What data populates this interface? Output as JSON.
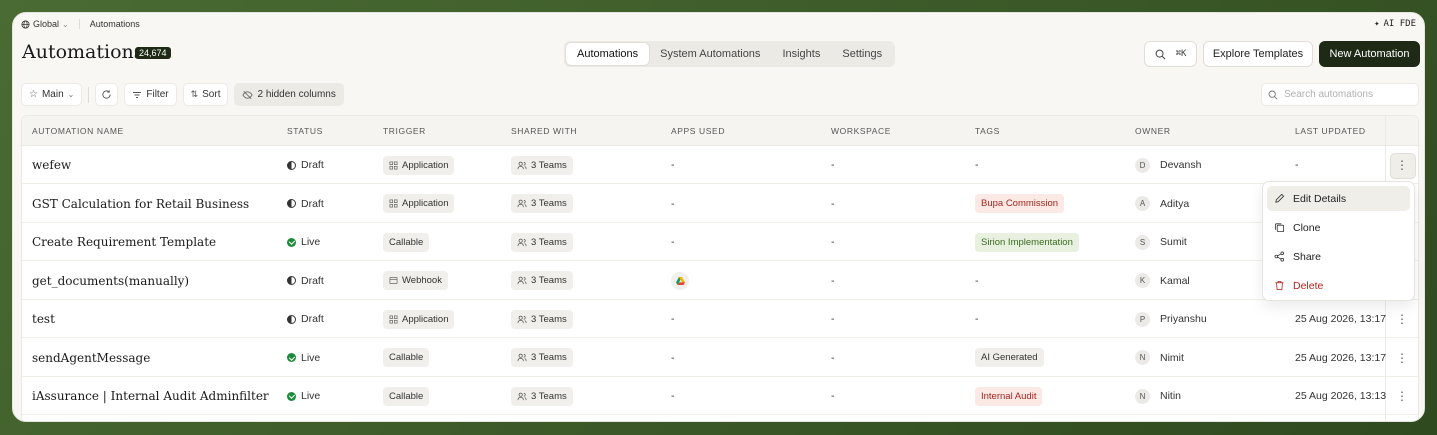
{
  "topbar": {
    "scope": "Global",
    "breadcrumb": "Automations",
    "brand": "AI FDE"
  },
  "header": {
    "title": "Automations",
    "count": "24,674",
    "tabs": [
      {
        "label": "Automations",
        "active": true
      },
      {
        "label": "System Automations",
        "active": false
      },
      {
        "label": "Insights",
        "active": false
      },
      {
        "label": "Settings",
        "active": false
      }
    ],
    "shortcut": "⌘K",
    "explore_label": "Explore Templates",
    "new_label": "New Automation"
  },
  "toolbar": {
    "view": "Main",
    "filter": "Filter",
    "sort": "Sort",
    "hidden_columns": "2 hidden columns",
    "search_placeholder": "Search automations"
  },
  "table": {
    "columns": [
      "AUTOMATION NAME",
      "STATUS",
      "TRIGGER",
      "SHARED WITH",
      "APPS USED",
      "WORKSPACE",
      "TAGS",
      "OWNER",
      "LAST UPDATED"
    ],
    "rows": [
      {
        "name": "wefew",
        "status": "Draft",
        "trigger": "Application",
        "shared": "3 Teams",
        "apps": "-",
        "workspace": "-",
        "tag": "-",
        "owner_initial": "D",
        "owner": "Devansh",
        "updated": "-"
      },
      {
        "name": "GST Calculation for Retail Business",
        "status": "Draft",
        "trigger": "Application",
        "shared": "3 Teams",
        "apps": "-",
        "workspace": "-",
        "tag": "Bupa Commission",
        "owner_initial": "A",
        "owner": "Aditya",
        "updated": ""
      },
      {
        "name": "Create Requirement Template",
        "status": "Live",
        "trigger": "Callable",
        "shared": "3 Teams",
        "apps": "-",
        "workspace": "-",
        "tag": "Sirion Implementation",
        "owner_initial": "S",
        "owner": "Sumit",
        "updated": ""
      },
      {
        "name": "get_documents(manually)",
        "status": "Draft",
        "trigger": "Webhook",
        "shared": "3 Teams",
        "apps": "",
        "workspace": "-",
        "tag": "-",
        "owner_initial": "K",
        "owner": "Kamal",
        "updated": ""
      },
      {
        "name": "test",
        "status": "Draft",
        "trigger": "Application",
        "shared": "3 Teams",
        "apps": "-",
        "workspace": "-",
        "tag": "-",
        "owner_initial": "P",
        "owner": "Priyanshu",
        "updated": "25 Aug 2026, 13:17"
      },
      {
        "name": "sendAgentMessage",
        "status": "Live",
        "trigger": "Callable",
        "shared": "3 Teams",
        "apps": "-",
        "workspace": "-",
        "tag": "AI Generated",
        "owner_initial": "N",
        "owner": "Nimit",
        "updated": "25 Aug 2026, 13:17"
      },
      {
        "name": "iAssurance | Internal Audit Adminfilter",
        "status": "Live",
        "trigger": "Callable",
        "shared": "3 Teams",
        "apps": "-",
        "workspace": "-",
        "tag": "Internal Audit",
        "owner_initial": "N",
        "owner": "Nitin",
        "updated": "25 Aug 2026, 13:13"
      }
    ]
  },
  "menu": {
    "items": [
      {
        "label": "Edit Details"
      },
      {
        "label": "Clone"
      },
      {
        "label": "Share"
      },
      {
        "label": "Delete"
      }
    ]
  },
  "colors": {
    "accent": "#1f2a16",
    "live": "#1e8a3c",
    "danger": "#b3261e"
  }
}
